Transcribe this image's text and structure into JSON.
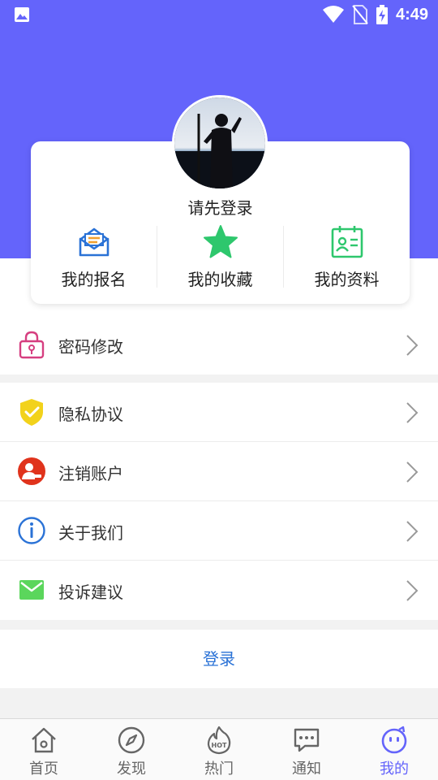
{
  "status_bar": {
    "time": "4:49",
    "icons": [
      "image-notification-icon",
      "wifi-icon",
      "no-sim-icon",
      "battery-charging-icon"
    ]
  },
  "profile": {
    "login_prompt": "请先登录",
    "quick_actions": [
      {
        "label": "我的报名",
        "icon": "envelope-icon",
        "color": "#2a72d6"
      },
      {
        "label": "我的收藏",
        "icon": "star-icon",
        "color": "#2ec76d"
      },
      {
        "label": "我的资料",
        "icon": "id-card-icon",
        "color": "#2ec76d"
      }
    ]
  },
  "menu_groups": [
    [
      {
        "label": "密码修改",
        "icon": "lock-icon",
        "color": "#d63f80"
      }
    ],
    [
      {
        "label": "隐私协议",
        "icon": "shield-check-icon",
        "color": "#f2d21b"
      },
      {
        "label": "注销账户",
        "icon": "user-remove-icon",
        "color": "#e0331c"
      },
      {
        "label": "关于我们",
        "icon": "info-icon",
        "color": "#2a72d6"
      },
      {
        "label": "投诉建议",
        "icon": "mail-icon",
        "color": "#5bd65c"
      }
    ]
  ],
  "login_button": "登录",
  "tabs": [
    {
      "label": "首页",
      "icon": "home-icon",
      "active": false
    },
    {
      "label": "发现",
      "icon": "compass-icon",
      "active": false
    },
    {
      "label": "热门",
      "icon": "hot-flame-icon",
      "active": false
    },
    {
      "label": "通知",
      "icon": "chat-bubble-icon",
      "active": false
    },
    {
      "label": "我的",
      "icon": "smiley-face-icon",
      "active": true
    }
  ],
  "colors": {
    "primary": "#6464fb",
    "link": "#2a72d6",
    "background": "#f2f2f2"
  }
}
